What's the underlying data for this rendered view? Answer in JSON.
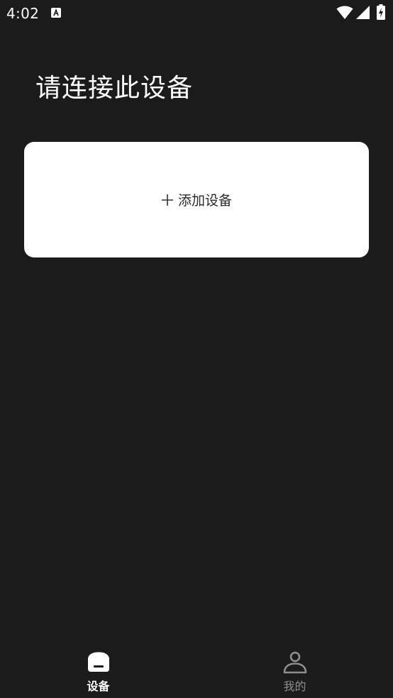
{
  "status_bar": {
    "time": "4:02"
  },
  "main": {
    "title": "请连接此设备",
    "add_card": {
      "label": "添加设备"
    }
  },
  "bottom_nav": {
    "items": [
      {
        "label": "设备",
        "icon": "device-icon",
        "active": true
      },
      {
        "label": "我的",
        "icon": "person-icon",
        "active": false
      }
    ]
  },
  "colors": {
    "background": "#1b1b1c",
    "card": "#ffffff",
    "active": "#ffffff",
    "inactive": "#8f8f8f"
  }
}
